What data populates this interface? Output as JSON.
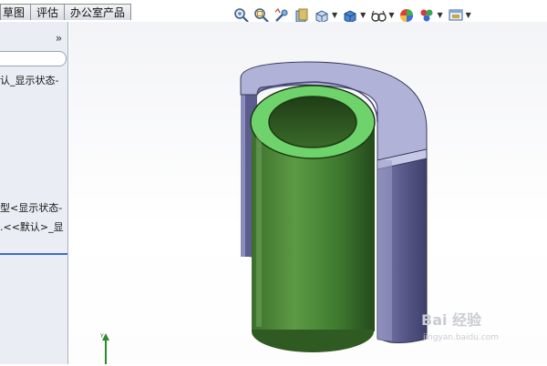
{
  "tabs": [
    {
      "label": "草图"
    },
    {
      "label": "评估"
    },
    {
      "label": "办公室产品"
    }
  ],
  "toolbar": {
    "icons": [
      "zoom-to-fit-icon",
      "zoom-area-icon",
      "previous-view-icon",
      "section-view-icon",
      "view-orientation-icon",
      "display-style-icon",
      "hide-show-items-icon",
      "edit-appearance-icon",
      "apply-scene-icon",
      "view-settings-icon"
    ]
  },
  "sidebar": {
    "collapse_glyph": "»",
    "tree_items": [
      {
        "label": "认_显示状态-"
      },
      {
        "label": "型<显示状态-"
      },
      {
        "label": ".<<默认>_显"
      }
    ]
  },
  "colors": {
    "cylinder_green": "#4f8c3a",
    "ring_green": "#6ed06a",
    "shell_purple": "#7a7aa8",
    "shell_top": "#b6b8dc",
    "viewport_bg": "#f6f7fa"
  },
  "watermark": {
    "text": "Bai 经验",
    "url": "jingyan.baidu.com"
  }
}
